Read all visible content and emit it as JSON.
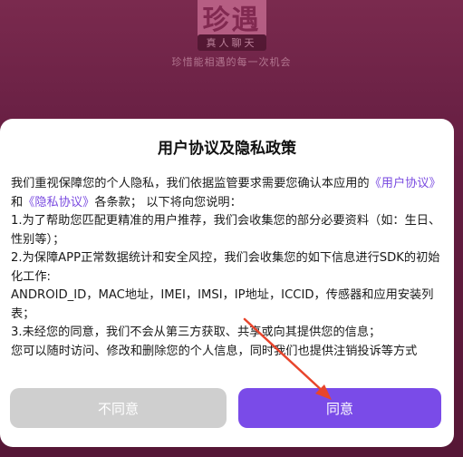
{
  "app": {
    "logo_text": "珍遇",
    "logo_badge": "真人聊天",
    "slogan": "珍惜能相遇的每一次机会"
  },
  "dialog": {
    "title": "用户协议及隐私政策",
    "body": {
      "intro_prefix": "我们重视保障您的个人隐私，我们依据监管要求需要您确认本应用的",
      "link_user_agreement": "《用户协议》",
      "and": "和",
      "link_privacy": "《隐私协议》",
      "intro_suffix": "各条款； 以下将向您说明：",
      "item1": "1.为了帮助您匹配更精准的用户推荐，我们会收集您的部分必要资料（如：生日、性别等）；",
      "item2": "2.为保障APP正常数据统计和安全风控，我们会收集您的如下信息进行SDK的初始化工作:",
      "item2_detail": "ANDROID_ID，MAC地址，IMEI，IMSI，IP地址，ICCID，传感器和应用安装列表；",
      "item3": "3.未经您的同意，我们不会从第三方获取、共享或向其提供您的信息；",
      "closing": "您可以随时访问、修改和删除您的个人信息，同时我们也提供注销投诉等方式"
    },
    "buttons": {
      "disagree": "不同意",
      "agree": "同意"
    }
  },
  "colors": {
    "accent": "#7a4be8",
    "link": "#7a4be0",
    "disabled_button": "#cfcfcf",
    "annotation_arrow": "#e8452c",
    "background": "#641d41"
  },
  "annotation": {
    "icon": "red-arrow-icon"
  }
}
